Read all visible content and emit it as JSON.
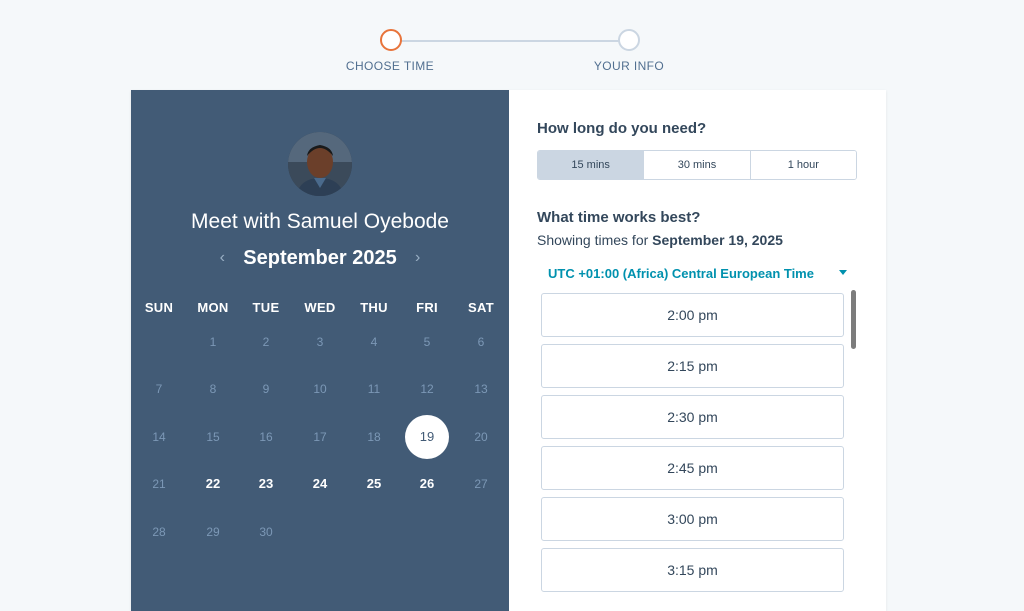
{
  "stepper": {
    "steps": [
      {
        "label": "CHOOSE TIME",
        "state": "active"
      },
      {
        "label": "YOUR INFO",
        "state": "inactive"
      }
    ]
  },
  "host": {
    "meet_title": "Meet with Samuel Oyebode"
  },
  "calendar": {
    "month_label": "September 2025",
    "prev_glyph": "‹",
    "next_glyph": "›",
    "weekdays": [
      "SUN",
      "MON",
      "TUE",
      "WED",
      "THU",
      "FRI",
      "SAT"
    ],
    "weeks": [
      [
        null,
        "1",
        "2",
        "3",
        "4",
        "5",
        "6"
      ],
      [
        "7",
        "8",
        "9",
        "10",
        "11",
        "12",
        "13"
      ],
      [
        "14",
        "15",
        "16",
        "17",
        "18",
        "19",
        "20"
      ],
      [
        "21",
        "22",
        "23",
        "24",
        "25",
        "26",
        "27"
      ],
      [
        "28",
        "29",
        "30",
        null,
        null,
        null,
        null
      ]
    ],
    "available": [
      "22",
      "23",
      "24",
      "25",
      "26"
    ],
    "selected": "19"
  },
  "duration": {
    "heading": "How long do you need?",
    "options": [
      "15 mins",
      "30 mins",
      "1 hour"
    ],
    "selected_index": 0
  },
  "times": {
    "heading": "What time works best?",
    "showing_prefix": "Showing times for ",
    "showing_date": "September 19, 2025",
    "timezone": "UTC +01:00 (Africa) Central European Time",
    "slots": [
      "2:00 pm",
      "2:15 pm",
      "2:30 pm",
      "2:45 pm",
      "3:00 pm",
      "3:15 pm"
    ]
  },
  "colors": {
    "accent_orange": "#e8743b",
    "panel_blue": "#425b76",
    "link_teal": "#0091ae"
  }
}
